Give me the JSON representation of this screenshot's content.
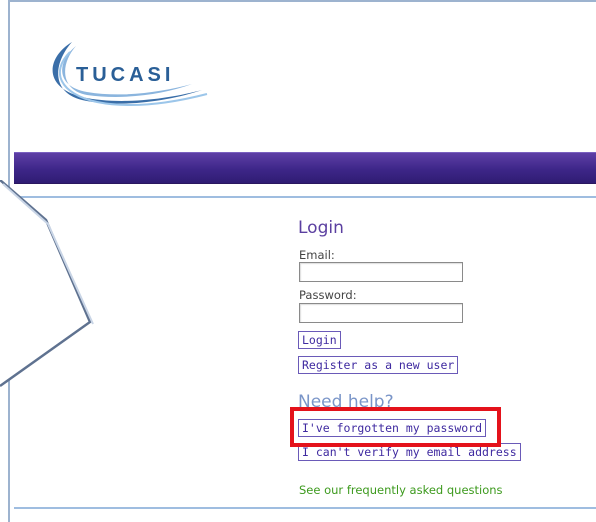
{
  "brand": {
    "logo_text": "TUCASI"
  },
  "login": {
    "title": "Login",
    "email_label": "Email:",
    "email_value": "",
    "password_label": "Password:",
    "password_value": "",
    "login_button": "Login",
    "register_button": "Register as a new user"
  },
  "help": {
    "title": "Need help?",
    "forgot_password": "I've forgotten my password",
    "verify_email": "I can't verify my email address",
    "faq_link": "See our frequently asked questions"
  },
  "colors": {
    "banner": "#3d2688",
    "title": "#5b3fa0",
    "link": "#3f2aa0",
    "faq": "#3d9a1e",
    "highlight": "#e4121b"
  }
}
